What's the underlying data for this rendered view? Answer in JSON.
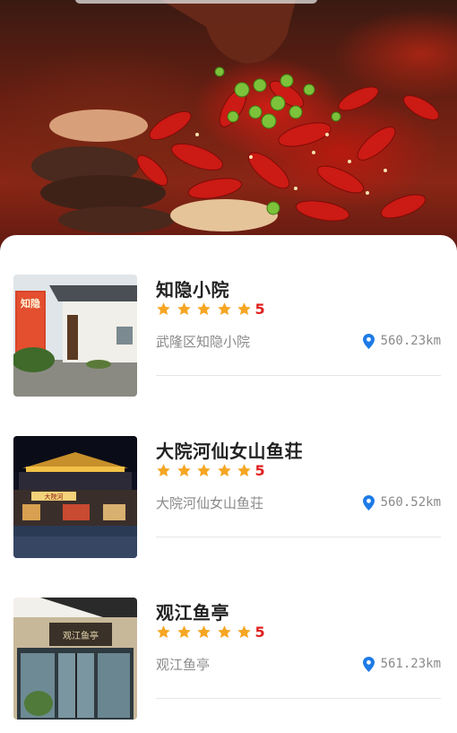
{
  "restaurants": [
    {
      "name": "知隐小院",
      "rating": "5",
      "stars": 5,
      "address": "武隆区知隐小院",
      "distance": "560.23km",
      "thumb_sign": "知隐"
    },
    {
      "name": "大院河仙女山鱼荘",
      "rating": "5",
      "stars": 5,
      "address": "大院河仙女山鱼荘",
      "distance": "560.52km",
      "thumb_sign": "大院河"
    },
    {
      "name": "观江鱼亭",
      "rating": "5",
      "stars": 5,
      "address": "观江鱼亭",
      "distance": "561.23km",
      "thumb_sign": "观江鱼亭"
    }
  ],
  "colors": {
    "star": "#f5a623",
    "rating": "#e02020",
    "pin": "#1e7be6",
    "accent_red": "#c8201a"
  }
}
